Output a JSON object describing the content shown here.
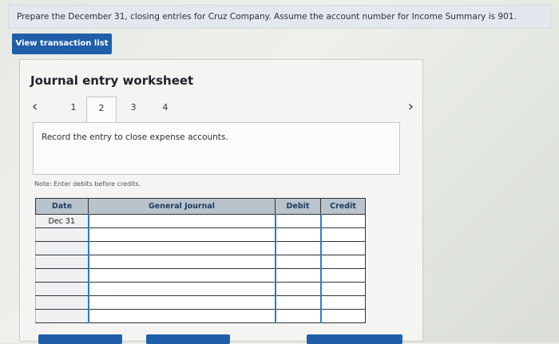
{
  "instruction": "Prepare the December 31, closing entries for Cruz Company. Assume the account number for Income Summary is 901.",
  "view_transaction_button": "View transaction list",
  "worksheet": {
    "title": "Journal entry worksheet",
    "tabs": [
      {
        "label": "1"
      },
      {
        "label": "2"
      },
      {
        "label": "3"
      },
      {
        "label": "4"
      }
    ],
    "active_tab": "2",
    "entry_description": "Record the entry to close expense accounts.",
    "note": "Note: Enter debits before credits.",
    "table": {
      "headers": [
        "Date",
        "General Journal",
        "Debit",
        "Credit"
      ],
      "rows": [
        {
          "date": "Dec 31",
          "account": "",
          "debit": "",
          "credit": ""
        },
        {
          "date": "",
          "account": "",
          "debit": "",
          "credit": ""
        },
        {
          "date": "",
          "account": "",
          "debit": "",
          "credit": ""
        },
        {
          "date": "",
          "account": "",
          "debit": "",
          "credit": ""
        },
        {
          "date": "",
          "account": "",
          "debit": "",
          "credit": ""
        },
        {
          "date": "",
          "account": "",
          "debit": "",
          "credit": ""
        },
        {
          "date": "",
          "account": "",
          "debit": "",
          "credit": ""
        },
        {
          "date": "",
          "account": "",
          "debit": "",
          "credit": ""
        }
      ]
    }
  },
  "icons": {
    "prev": "chevron-left-icon",
    "next": "chevron-right-icon"
  },
  "colors": {
    "button_blue": "#1f5fa9",
    "header_gray": "#b9c3cc"
  }
}
